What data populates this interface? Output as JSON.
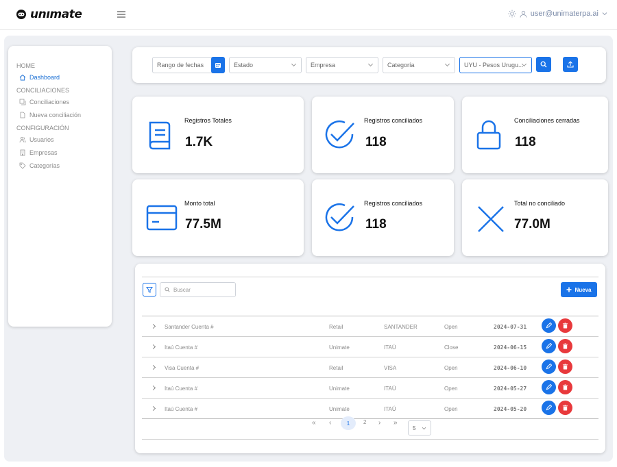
{
  "app": {
    "logo_text": "unımate",
    "user_email": "user@unimaterpa.ai"
  },
  "sidebar": {
    "sections": [
      {
        "title": "HOME",
        "items": [
          {
            "label": "Dashboard",
            "icon": "home-icon",
            "active": true
          }
        ]
      },
      {
        "title": "CONCILIACIONES",
        "items": [
          {
            "label": "Conciliaciones",
            "icon": "copy-icon"
          },
          {
            "label": "Nueva conciliación",
            "icon": "file-icon"
          }
        ]
      },
      {
        "title": "CONFIGURACIÓN",
        "items": [
          {
            "label": "Usuarios",
            "icon": "users-icon"
          },
          {
            "label": "Empresas",
            "icon": "building-icon"
          },
          {
            "label": "Categorías",
            "icon": "tag-icon"
          }
        ]
      }
    ]
  },
  "filters": {
    "date_placeholder": "Rango de fechas",
    "estado": "Estado",
    "empresa": "Empresa",
    "categoria": "Categoría",
    "currency": "UYU - Pesos Urugu..."
  },
  "cards": [
    {
      "title": "Registros Totales",
      "value": "1.7K",
      "icon": "book-icon"
    },
    {
      "title": "Registros conciliados",
      "value": "118",
      "icon": "check-circle-icon"
    },
    {
      "title": "Conciliaciones cerradas",
      "value": "118",
      "icon": "lock-icon"
    },
    {
      "title": "Monto total",
      "value": "77.5M",
      "icon": "credit-card-icon"
    },
    {
      "title": "Registros conciliados",
      "value": "118",
      "icon": "check-circle-icon"
    },
    {
      "title": "Total no conciliado",
      "value": "77.0M",
      "icon": "x-icon"
    }
  ],
  "table": {
    "search_placeholder": "Buscar",
    "new_button": "Nueva",
    "rows": [
      {
        "name": "Santander Cuenta #",
        "company": "Retail",
        "bank": "SANTANDER",
        "status": "Open",
        "date": "2024-07-31"
      },
      {
        "name": "Itaú Cuenta #",
        "company": "Unimate",
        "bank": "ITAÚ",
        "status": "Close",
        "date": "2024-06-15"
      },
      {
        "name": "Visa Cuenta #",
        "company": "Retail",
        "bank": "VISA",
        "status": "Open",
        "date": "2024-06-10"
      },
      {
        "name": "Itaú Cuenta #",
        "company": "Unimate",
        "bank": "ITAÚ",
        "status": "Open",
        "date": "2024-05-27"
      },
      {
        "name": "Itaú Cuenta #",
        "company": "Unimate",
        "bank": "ITAÚ",
        "status": "Open",
        "date": "2024-05-20"
      }
    ],
    "pagination": {
      "first": "«",
      "prev": "‹",
      "pages": [
        "1",
        "2"
      ],
      "current": "1",
      "next": "›",
      "last": "»",
      "page_size": "5"
    }
  },
  "colors": {
    "accent": "#1a73e8",
    "danger": "#e8393c",
    "background": "#eef0f4"
  }
}
